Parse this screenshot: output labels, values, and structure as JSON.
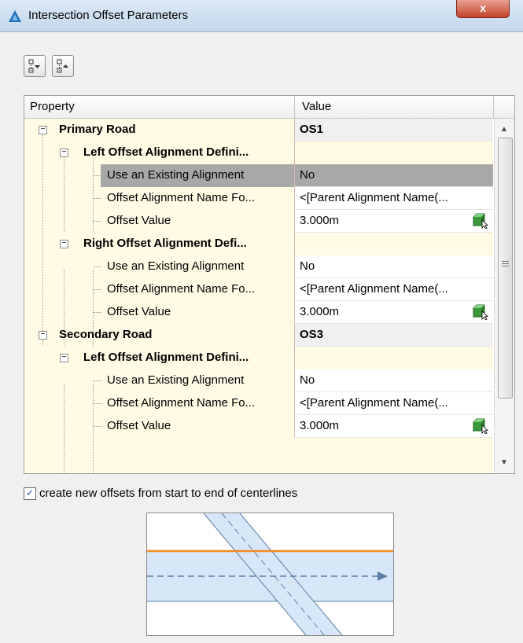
{
  "window": {
    "title": "Intersection Offset Parameters",
    "close_glyph": "x"
  },
  "toolbar": {
    "expand_icon": "expand-all-icon",
    "collapse_icon": "collapse-all-icon"
  },
  "grid": {
    "columns": [
      "Property",
      "Value"
    ],
    "rows": [
      {
        "label": "Primary Road",
        "value": "OS1",
        "kind": "category"
      },
      {
        "label": "Left Offset Alignment Defini...",
        "value": "",
        "kind": "group"
      },
      {
        "label": "Use an Existing Alignment",
        "value": "No",
        "kind": "item",
        "selected": true
      },
      {
        "label": "Offset Alignment Name Fo...",
        "value": "<[Parent Alignment Name(...",
        "kind": "item"
      },
      {
        "label": "Offset Value",
        "value": "3.000m",
        "kind": "item",
        "calc": true
      },
      {
        "label": "Right Offset Alignment Defi...",
        "value": "",
        "kind": "group"
      },
      {
        "label": "Use an Existing Alignment",
        "value": "No",
        "kind": "item"
      },
      {
        "label": "Offset Alignment Name Fo...",
        "value": "<[Parent Alignment Name(...",
        "kind": "item"
      },
      {
        "label": "Offset Value",
        "value": "3.000m",
        "kind": "item",
        "calc": true
      },
      {
        "label": "Secondary Road",
        "value": "OS3",
        "kind": "category"
      },
      {
        "label": "Left Offset Alignment Defini...",
        "value": "",
        "kind": "group"
      },
      {
        "label": "Use an Existing Alignment",
        "value": "No",
        "kind": "item"
      },
      {
        "label": "Offset Alignment Name Fo...",
        "value": "<[Parent Alignment Name(...",
        "kind": "item"
      },
      {
        "label": "Offset Value",
        "value": "3.000m",
        "kind": "item",
        "calc": true
      }
    ],
    "collapse_glyph": "−"
  },
  "options": {
    "create_new_offsets_checked": true,
    "create_new_offsets_label": "create new offsets from start to end of centerlines",
    "check_glyph": "✓"
  },
  "colors": {
    "offset_line": "#f08a24",
    "road_fill": "#d7e7f7",
    "centerline": "#5a7fa8",
    "selection": "#a8a8a8",
    "grid_background": "#fffbe5"
  }
}
